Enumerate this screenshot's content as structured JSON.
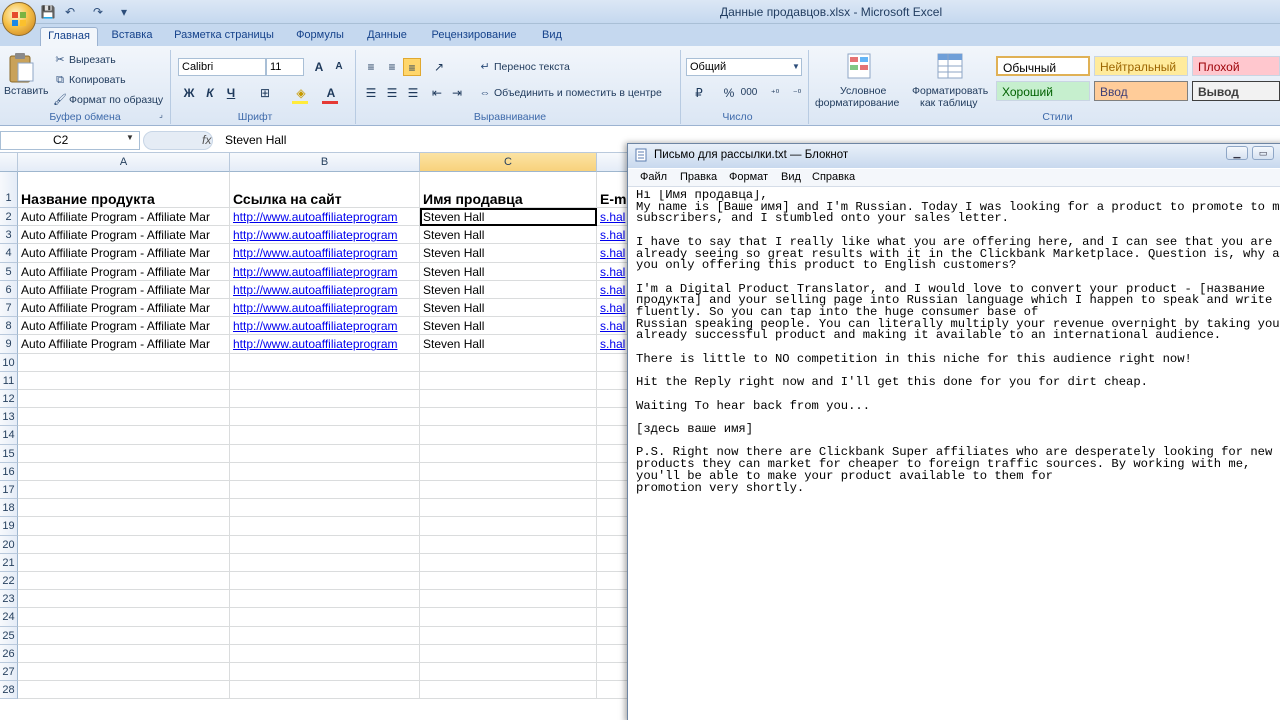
{
  "window_title": "Данные продавцов.xlsx - Microsoft Excel",
  "tabs": [
    "Главная",
    "Вставка",
    "Разметка страницы",
    "Формулы",
    "Данные",
    "Рецензирование",
    "Вид"
  ],
  "clipboard": {
    "paste": "Вставить",
    "cut": "Вырезать",
    "copy": "Копировать",
    "format_painter": "Формат по образцу",
    "label": "Буфер обмена"
  },
  "font": {
    "name": "Calibri",
    "size": "11",
    "label": "Шрифт",
    "bold": "Ж",
    "italic": "К",
    "underline": "Ч"
  },
  "alignment": {
    "wrap": "Перенос текста",
    "merge": "Объединить и поместить в центре",
    "label": "Выравнивание"
  },
  "number": {
    "format": "Общий",
    "label": "Число",
    "percent": "%",
    "thousands": "000"
  },
  "styles": {
    "conditional": [
      "Условное",
      "форматирование"
    ],
    "as_table": [
      "Форматировать",
      "как таблицу"
    ],
    "normal": "Обычный",
    "neutral": "Нейтральный",
    "bad": "Плохой",
    "good": "Хороший",
    "input": "Ввод",
    "output": "Вывод",
    "label": "Стили"
  },
  "formula_bar": {
    "cell_ref": "C2",
    "fx": "fx",
    "value": "Steven Hall"
  },
  "columns": [
    "A",
    "B",
    "C"
  ],
  "column_d_partial": "E-m",
  "rows": [
    "1",
    "2",
    "3",
    "4",
    "5",
    "6",
    "7",
    "8",
    "9",
    "10",
    "11",
    "12",
    "13",
    "14",
    "15",
    "16",
    "17",
    "18",
    "19",
    "20",
    "21",
    "22",
    "23",
    "24",
    "25",
    "26",
    "27",
    "28"
  ],
  "headers": [
    "Название продукта",
    "Ссылка на сайт",
    "Имя продавца",
    "E-m"
  ],
  "data_rows": [
    [
      "Auto Affiliate Program - Affiliate Mar",
      "http://www.autoaffiliateprogram",
      "Steven Hall",
      "s.hal"
    ],
    [
      "Auto Affiliate Program - Affiliate Mar",
      "http://www.autoaffiliateprogram",
      "Steven Hall",
      "s.hal"
    ],
    [
      "Auto Affiliate Program - Affiliate Mar",
      "http://www.autoaffiliateprogram",
      "Steven Hall",
      "s.hal"
    ],
    [
      "Auto Affiliate Program - Affiliate Mar",
      "http://www.autoaffiliateprogram",
      "Steven Hall",
      "s.hal"
    ],
    [
      "Auto Affiliate Program - Affiliate Mar",
      "http://www.autoaffiliateprogram",
      "Steven Hall",
      "s.hal"
    ],
    [
      "Auto Affiliate Program - Affiliate Mar",
      "http://www.autoaffiliateprogram",
      "Steven Hall",
      "s.hal"
    ],
    [
      "Auto Affiliate Program - Affiliate Mar",
      "http://www.autoaffiliateprogram",
      "Steven Hall",
      "s.hal"
    ],
    [
      "Auto Affiliate Program - Affiliate Mar",
      "http://www.autoaffiliateprogram",
      "Steven Hall",
      "s.hal"
    ]
  ],
  "notepad": {
    "title": "Письмо для рассылки.txt — Блокнот",
    "menu": [
      "Файл",
      "Правка",
      "Формат",
      "Вид",
      "Справка"
    ],
    "text": "Hi [Имя продавца],\nMy name is [Ваше имя] and I'm Russian. Today I was looking for a product to promote to my\nsubscribers, and I stumbled onto your sales letter.\n\nI have to say that I really like what you are offering here, and I can see that you are\nalready seeing so great results with it in the Clickbank Marketplace. Question is, why are\nyou only offering this product to English customers?\n\nI'm a Digital Product Translator, and I would love to convert your product - [название\nпродукта] and your selling page into Russian language which I happen to speak and write\nfluently. So you can tap into the huge consumer base of\nRussian speaking people. You can literally multiply your revenue overnight by taking your\nalready successful product and making it available to an international audience.\n\nThere is little to NO competition in this niche for this audience right now!\n\nHit the Reply right now and I'll get this done for you for dirt cheap.\n\nWaiting To hear back from you...\n\n[здесь ваше имя]\n\nP.S. Right now there are Clickbank Super affiliates who are desperately looking for new\nproducts they can market for cheaper to foreign traffic sources. By working with me,\nyou'll be able to make your product available to them for\npromotion very shortly."
  }
}
